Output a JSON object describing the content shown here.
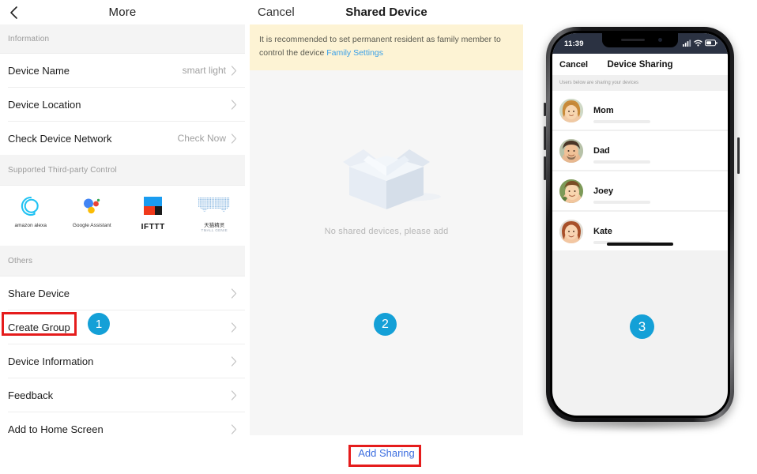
{
  "left_panel": {
    "nav": {
      "back_icon": "chevron-left-icon",
      "title": "More"
    },
    "sections": [
      {
        "header": "Information",
        "rows": [
          {
            "label": "Device Name",
            "value": "smart light"
          },
          {
            "label": "Device Location",
            "value": ""
          },
          {
            "label": "Check Device Network",
            "value": "Check Now"
          }
        ]
      },
      {
        "header": "Supported Third-party Control",
        "logos": [
          {
            "name": "amazon alexa",
            "sub": "",
            "icon": "amazon-alexa-icon"
          },
          {
            "name": "Google Assistant",
            "sub": "",
            "icon": "google-assistant-icon"
          },
          {
            "name": "IFTTT",
            "sub": "",
            "icon": "ifttt-icon"
          },
          {
            "name": "天猫精灵",
            "sub": "TMALL GENIE",
            "icon": "tmall-genie-icon"
          }
        ]
      },
      {
        "header": "Others",
        "rows": [
          {
            "label": "Share Device",
            "value": ""
          },
          {
            "label": "Create Group",
            "value": ""
          },
          {
            "label": "Device Information",
            "value": ""
          },
          {
            "label": "Feedback",
            "value": ""
          },
          {
            "label": "Add to Home Screen",
            "value": ""
          }
        ]
      }
    ]
  },
  "mid_panel": {
    "nav": {
      "cancel": "Cancel",
      "title": "Shared Device"
    },
    "banner": {
      "text": "It is recommended to set permanent resident as family member to control the device",
      "link": "Family Settings"
    },
    "empty_state": {
      "illustration": "empty-box-icon",
      "text": "No shared devices, please add"
    },
    "footer": {
      "add_sharing": "Add Sharing"
    }
  },
  "phone": {
    "status": {
      "time": "11:39",
      "signal_icon": "signal-bars-icon",
      "wifi_icon": "wifi-icon",
      "battery_icon": "battery-icon"
    },
    "nav": {
      "cancel": "Cancel",
      "title": "Device Sharing"
    },
    "subhead": "Users below are sharing your devices",
    "users": [
      {
        "name": "Mom",
        "avatar": "avatar-mom"
      },
      {
        "name": "Dad",
        "avatar": "avatar-dad"
      },
      {
        "name": "Joey",
        "avatar": "avatar-joey"
      },
      {
        "name": "Kate",
        "avatar": "avatar-kate"
      }
    ]
  },
  "annotations": {
    "badges": [
      "1",
      "2",
      "3"
    ],
    "badge_color": "#14a0d7",
    "highlight_color": "#e51c1c"
  }
}
